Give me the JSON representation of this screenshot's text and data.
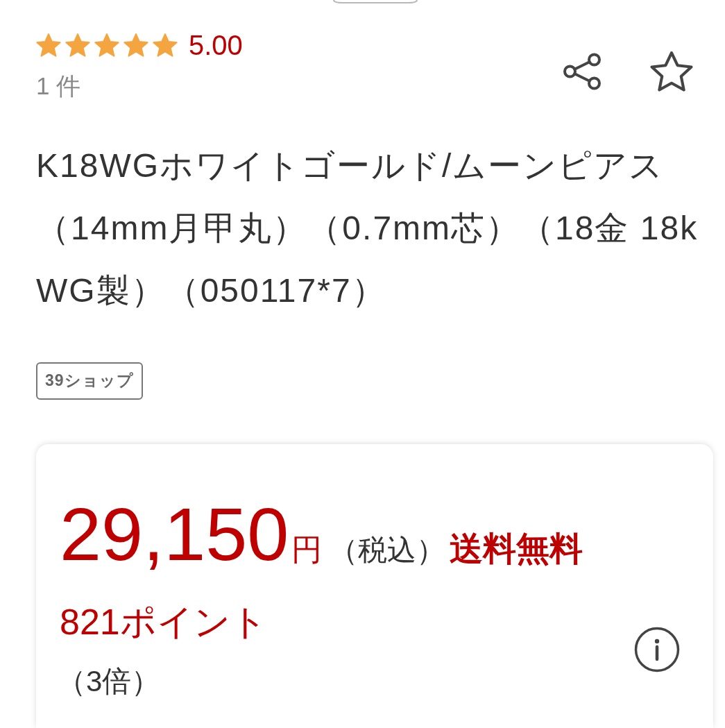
{
  "rating": {
    "stars": 5,
    "score": "5.00",
    "count": "1 件"
  },
  "title": "K18WGホワイトゴールド/ムーンピアス（14mm月甲丸）（0.7mm芯）（18金 18k WG製）（050117*7）",
  "shop_tags": [
    "39ショップ"
  ],
  "price_card": {
    "price": "29,150",
    "currency": "円",
    "tax_note": "（税込）",
    "shipping": "送料無料",
    "points": "821ポイント",
    "multiplier": "（3倍）"
  }
}
